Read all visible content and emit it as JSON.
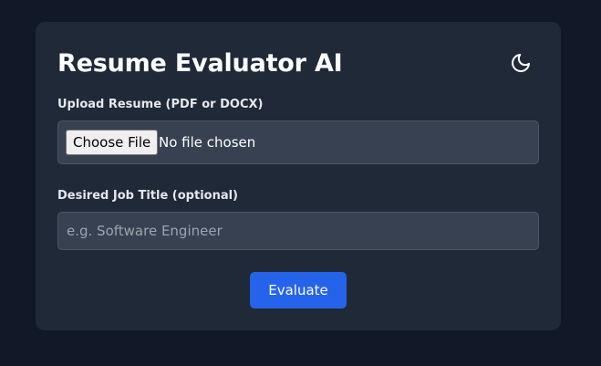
{
  "app": {
    "title": "Resume Evaluator AI",
    "theme_toggle_icon": "moon-icon"
  },
  "form": {
    "upload_label": "Upload Resume (PDF or DOCX)",
    "file_button_label": "Choose File",
    "file_status": "No file chosen",
    "job_title_label": "Desired Job Title (optional)",
    "job_title_value": "",
    "job_title_placeholder": "e.g. Software Engineer",
    "submit_label": "Evaluate"
  },
  "colors": {
    "page_background": "#111827",
    "card_background": "#1f2937",
    "input_background": "#374151",
    "accent": "#2563eb"
  }
}
